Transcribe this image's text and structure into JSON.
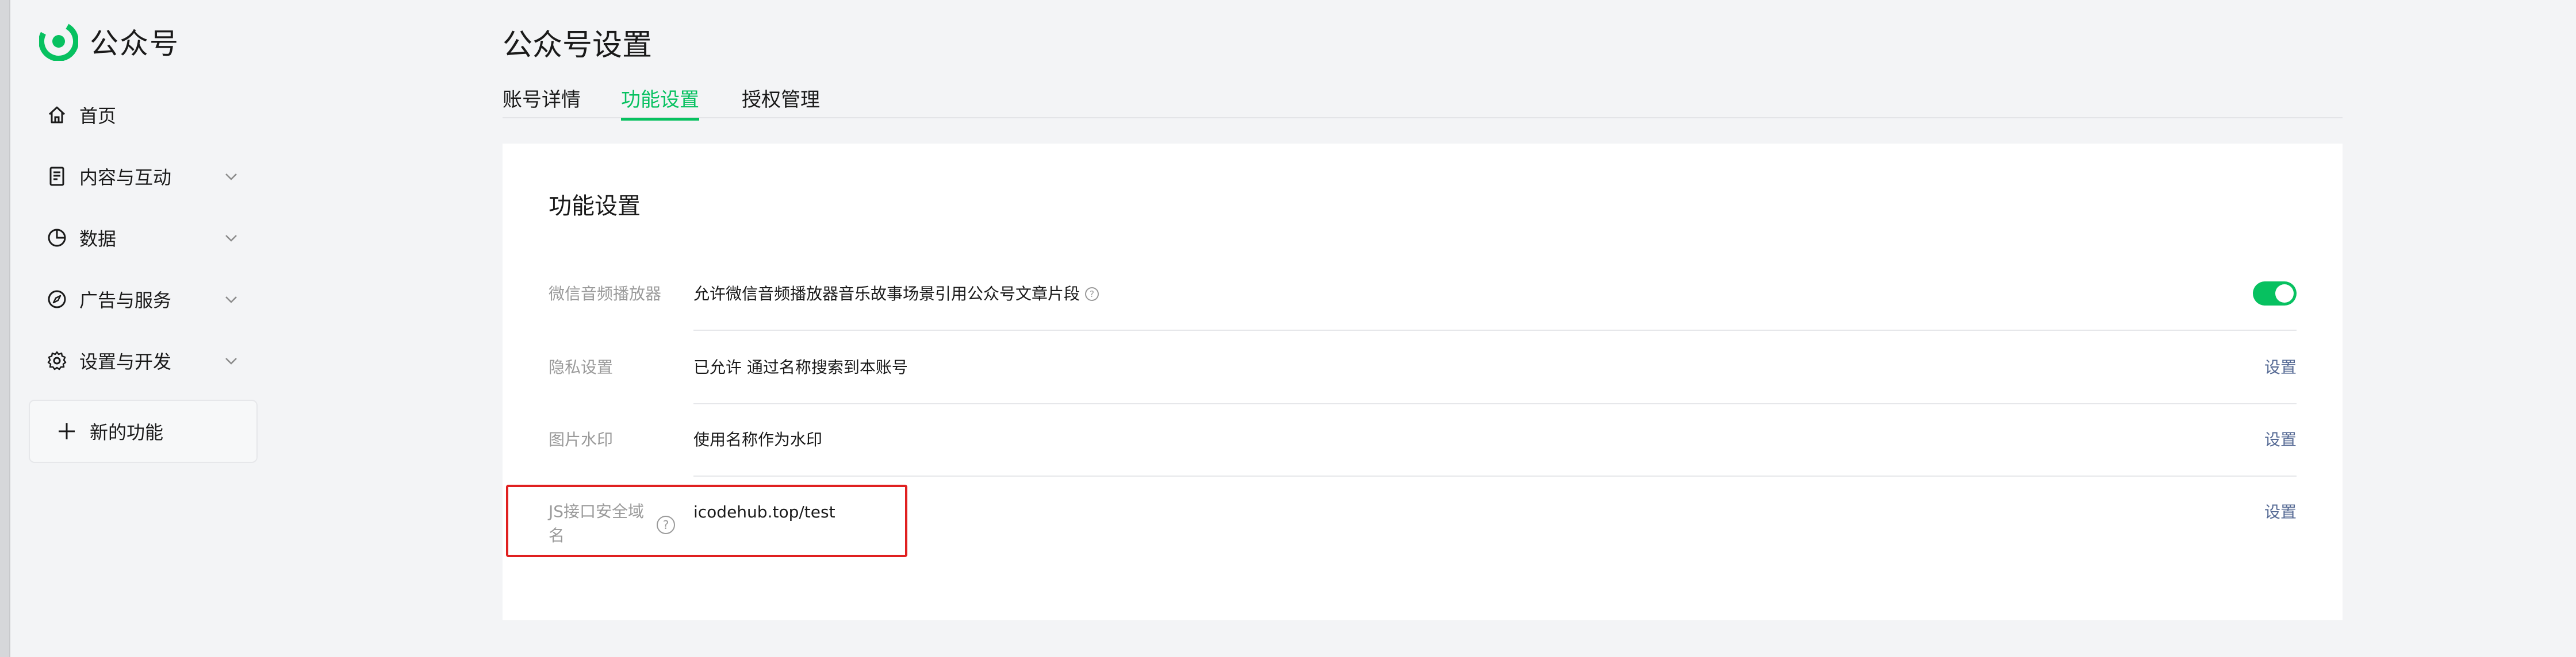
{
  "app": {
    "logo_text": "公众号"
  },
  "sidebar": {
    "items": [
      {
        "label": "首页",
        "icon": "home-icon",
        "has_chevron": false
      },
      {
        "label": "内容与互动",
        "icon": "document-icon",
        "has_chevron": true
      },
      {
        "label": "数据",
        "icon": "pie-chart-icon",
        "has_chevron": true
      },
      {
        "label": "广告与服务",
        "icon": "compass-icon",
        "has_chevron": true
      },
      {
        "label": "设置与开发",
        "icon": "gear-icon",
        "has_chevron": true
      }
    ],
    "new_feature": {
      "label": "新的功能",
      "icon": "plus-icon"
    }
  },
  "header": {
    "title": "公众号设置",
    "tabs": [
      {
        "label": "账号详情",
        "active": false
      },
      {
        "label": "功能设置",
        "active": true
      },
      {
        "label": "授权管理",
        "active": false
      }
    ]
  },
  "panel": {
    "title": "功能设置",
    "rows": [
      {
        "label": "微信音频播放器",
        "value": "允许微信音频播放器音乐故事场景引用公众号文章片段",
        "action_type": "toggle",
        "toggle_on": true,
        "has_help": true
      },
      {
        "label": "隐私设置",
        "value": "已允许 通过名称搜索到本账号",
        "action_type": "link",
        "action": "设置"
      },
      {
        "label": "图片水印",
        "value": "使用名称作为水印",
        "action_type": "link",
        "action": "设置"
      },
      {
        "label": "JS接口安全域名",
        "value": "icodehub.top/test",
        "action_type": "link",
        "action": "设置",
        "has_help": true,
        "highlighted": true
      }
    ]
  },
  "colors": {
    "accent": "#07c160",
    "link": "#576b95",
    "highlight": "#e02020",
    "label": "#9a9a9a"
  }
}
